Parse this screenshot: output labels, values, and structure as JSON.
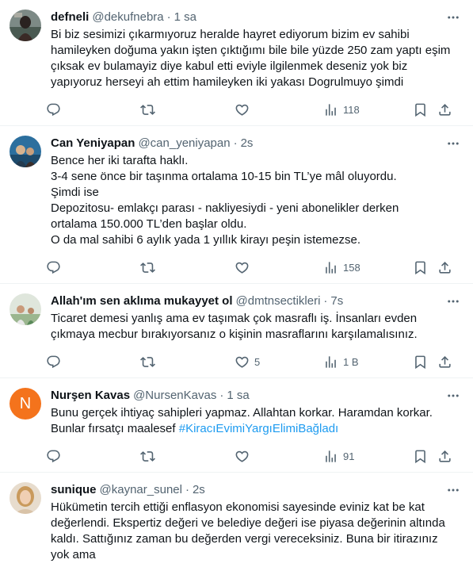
{
  "tweets": [
    {
      "name": "defneli",
      "handle": "@dekufnebra",
      "time": "1 sa",
      "lines": [
        "Bi biz sesimizi çıkarmıyoruz heralde hayret ediyorum bizim ev sahibi",
        "hamileyken doğuma yakın işten çıktığımı bile bile yüzde 250 zam yaptı eşim",
        "çıksak ev bulamayiz diye kabul etti eviyle ilgilenmek deseniz yok biz",
        "yapıyoruz herseyi ah ettim hamileyken iki yakası Dogrulmuyo şimdi"
      ],
      "reply_count": "",
      "retweet_count": "",
      "like_count": "",
      "views": "118"
    },
    {
      "name": "Can Yeniyapan",
      "handle": "@can_yeniyapan",
      "time": "2s",
      "lines": [
        "Bence her iki tarafta haklı.",
        "3-4 sene önce bir taşınma ortalama 10-15 bin TL’ye mâl oluyordu.",
        "Şimdi ise",
        "Depozitosu- emlakçı parası - nakliyesiydi - yeni abonelikler derken",
        "ortalama 150.000 TL’den başlar oldu.",
        "O da mal sahibi 6 aylık yada 1 yıllık kirayı peşin istemezse."
      ],
      "reply_count": "",
      "retweet_count": "",
      "like_count": "",
      "views": "158"
    },
    {
      "name": "Allah'ım sen aklıma mukayyet ol",
      "handle": "@dmtnsectikleri",
      "time": "7s",
      "lines": [
        "Ticaret demesi yanlış ama ev taşımak çok masraflı iş. İnsanları evden",
        "çıkmaya mecbur bırakıyorsanız o kişinin masraflarını karşılamalısınız."
      ],
      "reply_count": "",
      "retweet_count": "",
      "like_count": "5",
      "views": "1 B"
    },
    {
      "name": "Nurşen Kavas",
      "handle": "@NursenKavas",
      "time": "1 sa",
      "avatar_letter": "N",
      "lines": [
        "Bunu gerçek ihtiyaç sahipleri yapmaz. Allahtan korkar. Haramdan korkar.",
        "Bunlar fırsatçı maalesef"
      ],
      "hashtag": "#KiracıEvimiYargıElimiBağladı",
      "reply_count": "",
      "retweet_count": "",
      "like_count": "",
      "views": "91"
    },
    {
      "name": "sunique",
      "handle": "@kaynar_sunel",
      "time": "2s",
      "lines": [
        "Hükümetin tercih ettiği enflasyon ekonomisi sayesinde eviniz kat be kat",
        "değerlendi. Ekspertiz değeri ve belediye değeri ise piyasa değerinin altında",
        "kaldı. Sattığınız zaman bu değerden vergi vereceksiniz. Buna bir itirazınız",
        "yok ama"
      ]
    }
  ],
  "icons": {
    "more": "more-icon",
    "reply": "reply-icon",
    "retweet": "retweet-icon",
    "like": "like-icon",
    "views": "views-icon",
    "bookmark": "bookmark-icon",
    "share": "share-icon"
  },
  "colors": {
    "text": "#0f1419",
    "secondary": "#536471",
    "link": "#1d9bf0",
    "divider": "#eff3f4",
    "nursen_avatar": "#f4731c"
  }
}
